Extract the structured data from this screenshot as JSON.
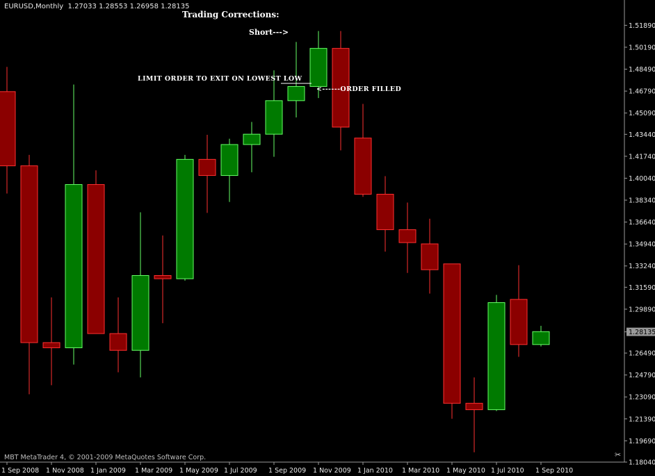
{
  "header": {
    "symbol": "EURUSD,Monthly",
    "ohlc": "1.27033 1.28553 1.26958 1.28135"
  },
  "annotations": {
    "title": "Trading Corrections:",
    "short": "Short--->",
    "limit_order": "LIMIT ORDER TO EXIT ON LOWEST LOW",
    "order_filled": "<------ORDER FILLED"
  },
  "footer": "MBT MetaTrader 4, © 2001-2009 MetaQuotes Software Corp.",
  "colors": {
    "bull_fill": "#007a00",
    "bull_outline": "#66ff66",
    "bear_fill": "#8b0000",
    "bear_outline": "#ff3030",
    "axis": "#9a9a9a",
    "text": "#ffffff",
    "current_price_bg": "#9a9a9a"
  },
  "chart_data": {
    "type": "candlestick",
    "title": "EURUSD,Monthly",
    "xlabel": "",
    "ylabel": "",
    "ylim": [
      1.1804,
      1.5245
    ],
    "grid": false,
    "current_price": "1.28135",
    "y_ticks": [
      "1.51890",
      "1.50190",
      "1.48490",
      "1.46790",
      "1.45090",
      "1.43440",
      "1.41740",
      "1.40040",
      "1.38340",
      "1.36640",
      "1.34940",
      "1.33240",
      "1.31590",
      "1.29890",
      "1.28135",
      "1.26490",
      "1.24790",
      "1.23090",
      "1.21390",
      "1.19690",
      "1.18040"
    ],
    "x_ticks": [
      {
        "label": "1 Sep 2008",
        "index": 0
      },
      {
        "label": "1 Nov 2008",
        "index": 2
      },
      {
        "label": "1 Jan 2009",
        "index": 4
      },
      {
        "label": "1 Mar 2009",
        "index": 6
      },
      {
        "label": "1 May 2009",
        "index": 8
      },
      {
        "label": "1 Jul 2009",
        "index": 10
      },
      {
        "label": "1 Sep 2009",
        "index": 12
      },
      {
        "label": "1 Nov 2009",
        "index": 14
      },
      {
        "label": "1 Jan 2010",
        "index": 16
      },
      {
        "label": "1 Mar 2010",
        "index": 18
      },
      {
        "label": "1 May 2010",
        "index": 20
      },
      {
        "label": "1 Jul 2010",
        "index": 22
      },
      {
        "label": "1 Sep 2010",
        "index": 24
      }
    ],
    "candles": [
      {
        "open": 1.4675,
        "high": 1.4867,
        "low": 1.3885,
        "close": 1.41
      },
      {
        "open": 1.41,
        "high": 1.4185,
        "low": 1.233,
        "close": 1.273
      },
      {
        "open": 1.273,
        "high": 1.308,
        "low": 1.24,
        "close": 1.269
      },
      {
        "open": 1.269,
        "high": 1.473,
        "low": 1.256,
        "close": 1.3955
      },
      {
        "open": 1.3955,
        "high": 1.4065,
        "low": 1.282,
        "close": 1.28
      },
      {
        "open": 1.28,
        "high": 1.308,
        "low": 1.25,
        "close": 1.267
      },
      {
        "open": 1.267,
        "high": 1.374,
        "low": 1.246,
        "close": 1.325
      },
      {
        "open": 1.325,
        "high": 1.356,
        "low": 1.288,
        "close": 1.3225
      },
      {
        "open": 1.3225,
        "high": 1.4185,
        "low": 1.321,
        "close": 1.415
      },
      {
        "open": 1.415,
        "high": 1.434,
        "low": 1.3735,
        "close": 1.4025
      },
      {
        "open": 1.4025,
        "high": 1.431,
        "low": 1.382,
        "close": 1.4265
      },
      {
        "open": 1.4265,
        "high": 1.444,
        "low": 1.405,
        "close": 1.4345
      },
      {
        "open": 1.4345,
        "high": 1.484,
        "low": 1.417,
        "close": 1.4605
      },
      {
        "open": 1.4605,
        "high": 1.506,
        "low": 1.4475,
        "close": 1.4715
      },
      {
        "open": 1.4715,
        "high": 1.5145,
        "low": 1.4625,
        "close": 1.501
      },
      {
        "open": 1.501,
        "high": 1.5145,
        "low": 1.422,
        "close": 1.44
      },
      {
        "open": 1.4315,
        "high": 1.458,
        "low": 1.386,
        "close": 1.388
      },
      {
        "open": 1.388,
        "high": 1.402,
        "low": 1.3435,
        "close": 1.3605
      },
      {
        "open": 1.3605,
        "high": 1.3815,
        "low": 1.327,
        "close": 1.3505
      },
      {
        "open": 1.3495,
        "high": 1.369,
        "low": 1.311,
        "close": 1.3295
      },
      {
        "open": 1.334,
        "high": 1.334,
        "low": 1.214,
        "close": 1.226
      },
      {
        "open": 1.226,
        "high": 1.246,
        "low": 1.188,
        "close": 1.221
      },
      {
        "open": 1.221,
        "high": 1.31,
        "low": 1.22,
        "close": 1.304
      },
      {
        "open": 1.3065,
        "high": 1.333,
        "low": 1.262,
        "close": 1.2715
      },
      {
        "open": 1.2715,
        "high": 1.286,
        "low": 1.27,
        "close": 1.2815
      }
    ]
  }
}
